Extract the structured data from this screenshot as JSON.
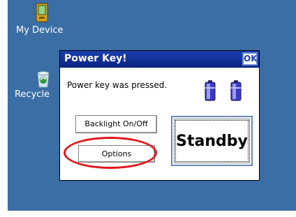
{
  "desktop": {
    "icons": [
      {
        "label": "My Device",
        "icon": "pda-device-icon"
      },
      {
        "label": "Recycle",
        "icon": "recycle-bin-icon"
      }
    ]
  },
  "dialog": {
    "title": "Power Key!",
    "ok_label": "OK",
    "message": "Power key was pressed.",
    "batteries": [
      "battery-icon",
      "battery-icon"
    ],
    "backlight_label": "Backlight On/Off",
    "options_label": "Options",
    "standby_label": "Standby"
  },
  "annotation": {
    "highlight": "options-button",
    "color": "#e0161c"
  },
  "colors": {
    "desktop": "#3a6ea5",
    "titlebar": "#0a2580",
    "title_text": "#ffffff"
  }
}
